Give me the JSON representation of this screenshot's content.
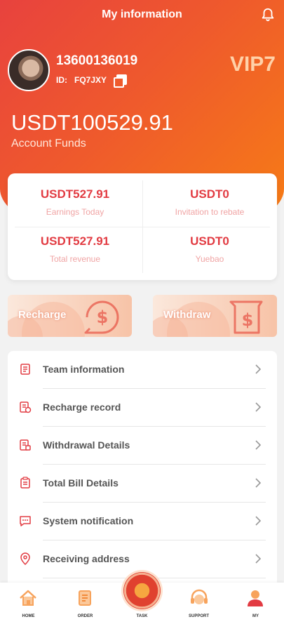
{
  "header": {
    "title": "My information"
  },
  "profile": {
    "phone": "13600136019",
    "id_label": "ID:",
    "id_value": "FQ7JXY",
    "vip": "VIP7"
  },
  "funds": {
    "value": "USDT100529.91",
    "label": "Account Funds"
  },
  "stats": [
    {
      "value": "USDT527.91",
      "label": "Earnings Today"
    },
    {
      "value": "USDT0",
      "label": "Invitation to rebate"
    },
    {
      "value": "USDT527.91",
      "label": "Total revenue"
    },
    {
      "value": "USDT0",
      "label": "Yuebao"
    }
  ],
  "actions": {
    "recharge": "Recharge",
    "withdraw": "Withdraw"
  },
  "menu": [
    {
      "label": "Team information",
      "icon": "team-icon"
    },
    {
      "label": "Recharge record",
      "icon": "recharge-record-icon"
    },
    {
      "label": "Withdrawal Details",
      "icon": "withdrawal-icon"
    },
    {
      "label": "Total Bill Details",
      "icon": "bill-icon"
    },
    {
      "label": "System notification",
      "icon": "message-icon"
    },
    {
      "label": "Receiving address",
      "icon": "location-icon"
    }
  ],
  "tabs": [
    {
      "label": "HOME",
      "icon": "home-icon"
    },
    {
      "label": "ORDER",
      "icon": "order-icon"
    },
    {
      "label": "TASK",
      "icon": "task-wheel-icon"
    },
    {
      "label": "SUPPORT",
      "icon": "support-icon"
    },
    {
      "label": "MY",
      "icon": "user-icon"
    }
  ],
  "colors": {
    "accent": "#e23b42",
    "gradient_start": "#e8423e",
    "gradient_end": "#f77f14"
  }
}
